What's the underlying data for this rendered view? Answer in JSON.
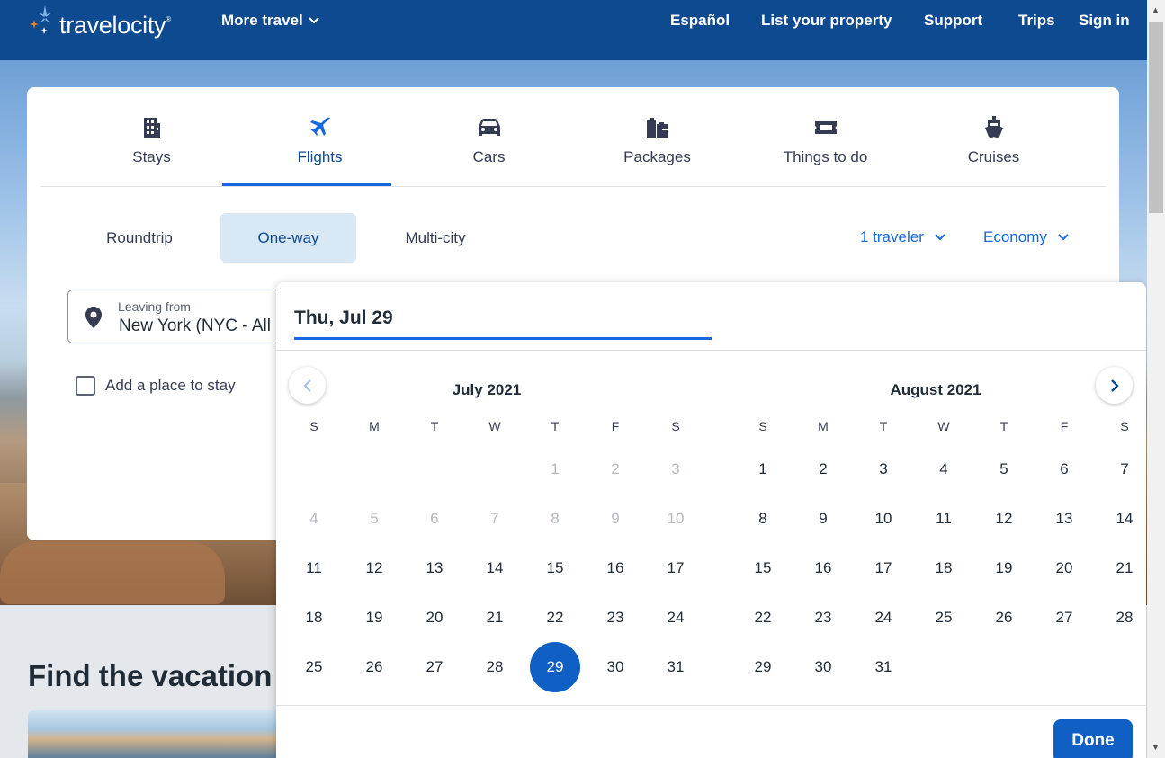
{
  "header": {
    "logo_text": "travelocity",
    "more_travel": "More travel",
    "nav": [
      "Español",
      "List your property",
      "Support",
      "Trips",
      "Sign in"
    ]
  },
  "tabs": [
    {
      "label": "Stays",
      "icon": "building-icon"
    },
    {
      "label": "Flights",
      "icon": "airplane-icon",
      "active": true
    },
    {
      "label": "Cars",
      "icon": "car-icon"
    },
    {
      "label": "Packages",
      "icon": "luggage-icon"
    },
    {
      "label": "Things to do",
      "icon": "ticket-icon"
    },
    {
      "label": "Cruises",
      "icon": "ship-icon"
    }
  ],
  "trip_types": [
    "Roundtrip",
    "One-way",
    "Multi-city"
  ],
  "travelers": "1 traveler",
  "cabin_class": "Economy",
  "leaving_from": {
    "label": "Leaving from",
    "value": "New York (NYC - All"
  },
  "add_place": "Add a place to stay",
  "background_heading": "Find the vacation",
  "calendar": {
    "selected_date": "Thu, Jul 29",
    "weekdays": [
      "S",
      "M",
      "T",
      "W",
      "T",
      "F",
      "S"
    ],
    "months": [
      {
        "title": "July 2021",
        "first_weekday": 4,
        "days_in_month": 31,
        "disabled_through": 10,
        "selected": 29
      },
      {
        "title": "August 2021",
        "first_weekday": 0,
        "days_in_month": 31,
        "disabled_through": 0,
        "selected": null
      }
    ],
    "done": "Done"
  },
  "colors": {
    "brand_blue": "#0e4a8f",
    "accent_blue": "#1668e3",
    "selected": "#0f5fc4"
  }
}
